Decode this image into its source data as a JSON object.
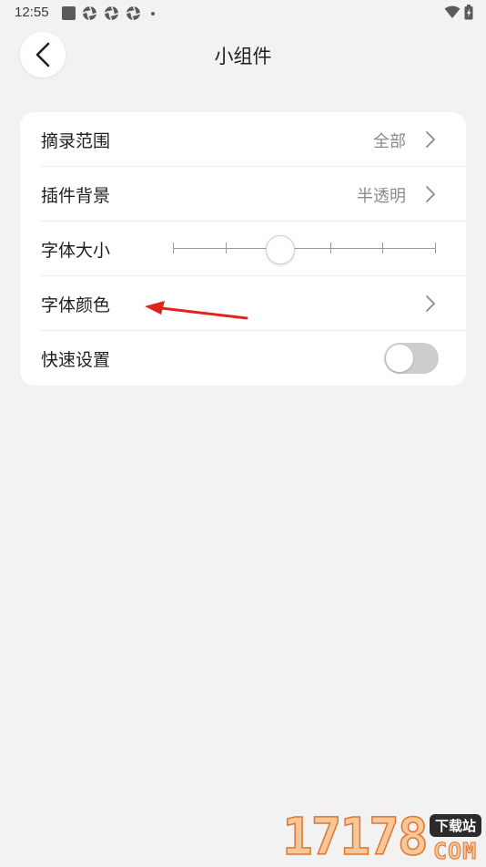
{
  "status_bar": {
    "time": "12:55"
  },
  "header": {
    "title": "小组件"
  },
  "settings": {
    "rows": [
      {
        "label": "摘录范围",
        "value": "全部"
      },
      {
        "label": "插件背景",
        "value": "半透明"
      },
      {
        "label": "字体大小",
        "slider_ticks": 6,
        "slider_position_index": 2
      },
      {
        "label": "字体颜色",
        "value": ""
      },
      {
        "label": "快速设置",
        "toggle_on": false
      }
    ]
  },
  "watermark": {
    "digits": "17178",
    "tag": "下载站",
    "suffix": "COM"
  },
  "colors": {
    "background": "#f2f2f3",
    "card": "#ffffff",
    "annotation_arrow": "#e0231c",
    "toggle_off": "#cdcdcd"
  }
}
